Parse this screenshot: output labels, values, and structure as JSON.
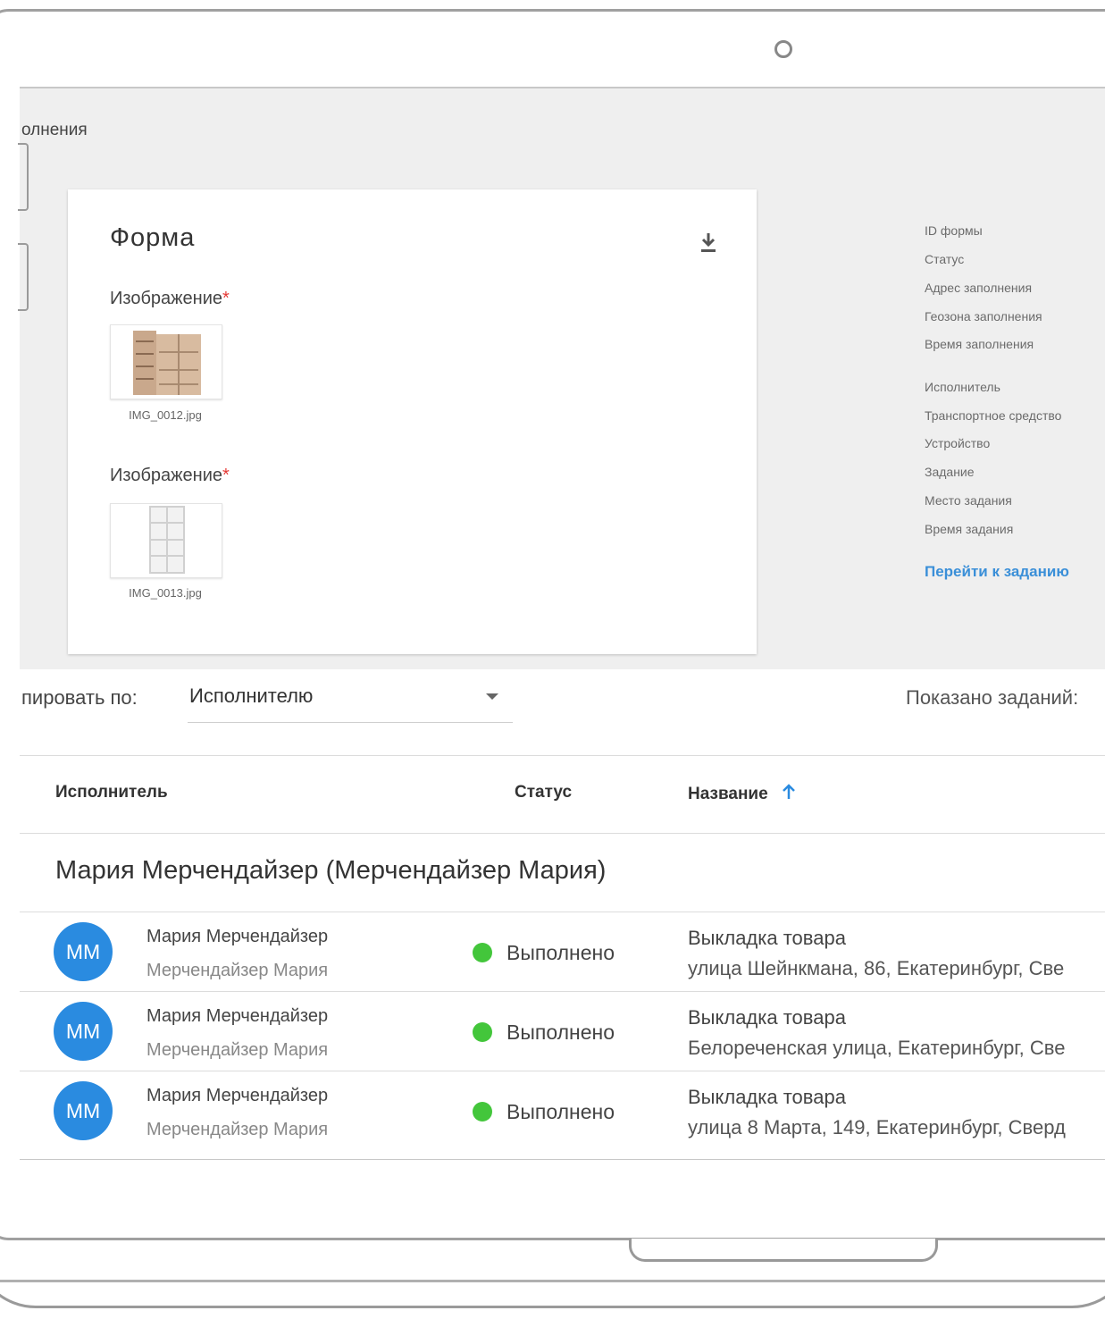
{
  "breadcrumb": "олнения",
  "card": {
    "title": "Форма",
    "fields": [
      {
        "label": "Изображение",
        "required_mark": "*",
        "file": "IMG_0012.jpg"
      },
      {
        "label": "Изображение",
        "required_mark": "*",
        "file": "IMG_0013.jpg"
      }
    ]
  },
  "meta": {
    "labels": [
      "ID формы",
      "Статус",
      "Адрес заполнения",
      "Геозона заполнения",
      "Время заполнения",
      "Исполнитель",
      "Транспортное средство",
      "Устройство",
      "Задание",
      "Место задания",
      "Время задания"
    ],
    "link": "Перейти к заданию"
  },
  "grouping": {
    "label": "пировать по:",
    "value": "Исполнителю"
  },
  "shown_label": "Показано заданий:",
  "table": {
    "headers": {
      "executor": "Исполнитель",
      "status": "Статус",
      "name": "Название"
    },
    "group_title": "Мария Мерчендайзер (Мерчендайзер Мария)",
    "rows": [
      {
        "initials": "ММ",
        "name": "Мария Мерчендайзер",
        "sub": "Мерчендайзер Мария",
        "status": "Выполнено",
        "task": "Выкладка товара",
        "address": "улица Шейнкмана, 86, Екатеринбург, Све"
      },
      {
        "initials": "ММ",
        "name": "Мария Мерчендайзер",
        "sub": "Мерчендайзер Мария",
        "status": "Выполнено",
        "task": "Выкладка товара",
        "address": "Белореченская улица, Екатеринбург, Све"
      },
      {
        "initials": "ММ",
        "name": "Мария Мерчендайзер",
        "sub": "Мерчендайзер Мария",
        "status": "Выполнено",
        "task": "Выкладка товара",
        "address": "улица 8 Марта, 149, Екатеринбург, Сверд"
      }
    ]
  },
  "colors": {
    "accent": "#2a8be0",
    "status_done": "#43c63b",
    "required": "#e53935",
    "link": "#3a8fd8"
  }
}
